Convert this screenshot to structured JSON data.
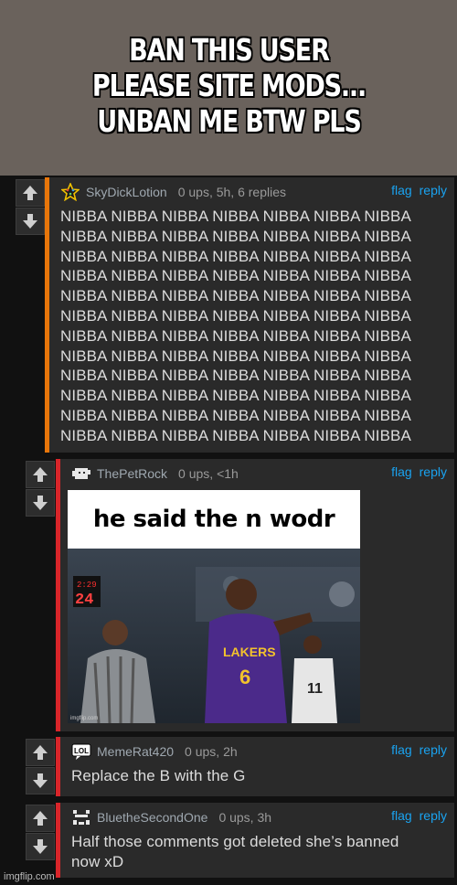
{
  "caption": {
    "line1": "BAN THIS USER",
    "line2": "PLEASE SITE MODS...",
    "line3": "UNBAN ME BTW PLS"
  },
  "comments": [
    {
      "username": "SkyDickLotion",
      "meta": "0 ups, 5h, 6 replies",
      "flag": "flag",
      "reply": "reply",
      "lines": [
        "NIBBA NIBBA NIBBA NIBBA NIBBA NIBBA NIBBA",
        "NIBBA NIBBA NIBBA NIBBA NIBBA NIBBA NIBBA",
        "NIBBA NIBBA NIBBA NIBBA NIBBA NIBBA NIBBA",
        "NIBBA NIBBA NIBBA NIBBA NIBBA NIBBA NIBBA",
        "NIBBA NIBBA NIBBA NIBBA NIBBA NIBBA NIBBA",
        "NIBBA NIBBA NIBBA NIBBA NIBBA NIBBA NIBBA",
        "NIBBA NIBBA NIBBA NIBBA NIBBA NIBBA NIBBA",
        "NIBBA NIBBA NIBBA NIBBA NIBBA NIBBA NIBBA",
        "NIBBA NIBBA NIBBA NIBBA NIBBA NIBBA NIBBA",
        "NIBBA NIBBA NIBBA NIBBA NIBBA NIBBA NIBBA",
        "NIBBA NIBBA NIBBA NIBBA NIBBA NIBBA NIBBA",
        "NIBBA NIBBA NIBBA NIBBA NIBBA NIBBA NIBBA"
      ]
    },
    {
      "username": "ThePetRock",
      "meta": "0 ups, <1h",
      "flag": "flag",
      "reply": "reply",
      "image_caption": "he said the n wodr",
      "image_watermark": "imgflip.com",
      "scoreboard_time": "2:29",
      "scoreboard_shot": "24",
      "jersey_team": "LAKERS",
      "jersey_number": "6",
      "jersey_number_2": "11"
    },
    {
      "username": "MemeRat420",
      "meta": "0 ups, 2h",
      "flag": "flag",
      "reply": "reply",
      "avatar_text": "LOL",
      "text": "Replace the B with the G"
    },
    {
      "username": "BluetheSecondOne",
      "meta": "0 ups, 3h",
      "flag": "flag",
      "reply": "reply",
      "line1": "Half those comments got deleted she’s banned",
      "line2": "now xD"
    }
  ],
  "watermark": "imgflip.com",
  "colors": {
    "caption_bg": "#6a625c",
    "page_bg": "#111111",
    "comment_bg": "#2a2a2a",
    "orange_bar": "#e8760a",
    "red_bar": "#d9252a",
    "link": "#1aa3f0"
  }
}
